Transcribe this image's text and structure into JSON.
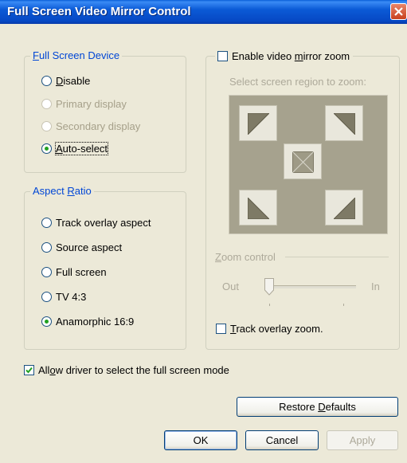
{
  "window": {
    "title": "Full Screen Video Mirror Control"
  },
  "device_group": {
    "label": "Full Screen Device",
    "options": [
      {
        "label": "Disable",
        "selected": false,
        "enabled": true
      },
      {
        "label": "Primary display",
        "selected": false,
        "enabled": false
      },
      {
        "label": "Secondary display",
        "selected": false,
        "enabled": false
      },
      {
        "label": "Auto-select",
        "selected": true,
        "enabled": true
      }
    ]
  },
  "aspect_group": {
    "label": "Aspect Ratio",
    "options": [
      {
        "label": "Track overlay aspect",
        "selected": false
      },
      {
        "label": "Source aspect",
        "selected": false
      },
      {
        "label": "Full screen",
        "selected": false
      },
      {
        "label": "TV 4:3",
        "selected": false
      },
      {
        "label": "Anamorphic 16:9",
        "selected": true
      }
    ]
  },
  "zoom_group": {
    "enable_label": "Enable video mirror zoom",
    "enable_checked": false,
    "region_label": "Select screen region to zoom:",
    "zoom_control_label": "Zoom control",
    "slider_out": "Out",
    "slider_in": "In",
    "track_label": "Track overlay zoom.",
    "track_checked": false
  },
  "allow_driver": {
    "label": "Allow driver to select the full screen mode",
    "checked": true
  },
  "buttons": {
    "restore": "Restore Defaults",
    "ok": "OK",
    "cancel": "Cancel",
    "apply": "Apply"
  }
}
